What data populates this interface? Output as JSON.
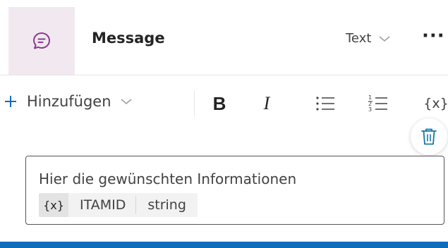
{
  "header": {
    "title": "Message",
    "type_label": "Text",
    "more_label": "···"
  },
  "toolbar": {
    "add_label": "Hinzufügen",
    "bold_label": "B",
    "italic_label": "I",
    "variable_label": "{x}"
  },
  "editor": {
    "text": "Hier die gewünschten Informationen",
    "variable": {
      "icon_label": "{x}",
      "name": "ITAMID",
      "type": "string"
    }
  },
  "colors": {
    "icon_tile_bg": "#f1e8f0",
    "icon_purple": "#8a3a8f",
    "accent_blue": "#0f6cbd",
    "trash_teal": "#1477a8"
  },
  "icons": [
    "chat-bubble-icon",
    "chevron-down-icon",
    "plus-icon",
    "bold-icon",
    "italic-icon",
    "bulleted-list-icon",
    "numbered-list-icon",
    "variable-icon",
    "trash-icon",
    "more-icon"
  ]
}
